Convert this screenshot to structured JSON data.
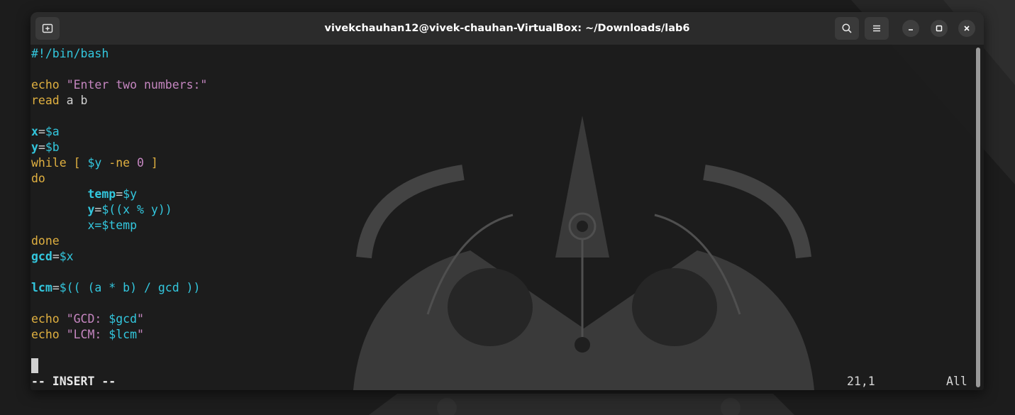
{
  "window": {
    "title": "vivekchauhan12@vivek-chauhan-VirtualBox: ~/Downloads/lab6"
  },
  "icons": {
    "new_tab": "new-tab-icon",
    "search": "search-icon",
    "menu": "hamburger-menu-icon",
    "minimize": "minimize-icon",
    "maximize": "maximize-icon",
    "close": "close-icon"
  },
  "editor": {
    "lines": [
      [
        {
          "t": "#!/bin/bash",
          "c": "shebang"
        }
      ],
      [],
      [
        {
          "t": "echo",
          "c": "kw"
        },
        {
          "t": " ",
          "c": "plain"
        },
        {
          "t": "\"Enter two numbers:\"",
          "c": "str"
        }
      ],
      [
        {
          "t": "read",
          "c": "kw"
        },
        {
          "t": " a b",
          "c": "plain"
        }
      ],
      [],
      [
        {
          "t": "x",
          "c": "var"
        },
        {
          "t": "=",
          "c": "plain"
        },
        {
          "t": "$a",
          "c": "exp"
        }
      ],
      [
        {
          "t": "y",
          "c": "var"
        },
        {
          "t": "=",
          "c": "plain"
        },
        {
          "t": "$b",
          "c": "exp"
        }
      ],
      [
        {
          "t": "while",
          "c": "kw"
        },
        {
          "t": " ",
          "c": "plain"
        },
        {
          "t": "[",
          "c": "kw"
        },
        {
          "t": " ",
          "c": "plain"
        },
        {
          "t": "$y",
          "c": "exp"
        },
        {
          "t": " ",
          "c": "plain"
        },
        {
          "t": "-ne",
          "c": "kw"
        },
        {
          "t": " ",
          "c": "plain"
        },
        {
          "t": "0",
          "c": "num"
        },
        {
          "t": " ",
          "c": "plain"
        },
        {
          "t": "]",
          "c": "kw"
        }
      ],
      [
        {
          "t": "do",
          "c": "kw"
        }
      ],
      [
        {
          "t": "        ",
          "c": "plain"
        },
        {
          "t": "temp",
          "c": "var"
        },
        {
          "t": "=",
          "c": "plain"
        },
        {
          "t": "$y",
          "c": "exp"
        }
      ],
      [
        {
          "t": "        ",
          "c": "plain"
        },
        {
          "t": "y",
          "c": "var"
        },
        {
          "t": "=",
          "c": "plain"
        },
        {
          "t": "$((x % y))",
          "c": "exp"
        }
      ],
      [
        {
          "t": "        ",
          "c": "plain"
        },
        {
          "t": "x=",
          "c": "exp"
        },
        {
          "t": "$temp",
          "c": "exp"
        }
      ],
      [
        {
          "t": "done",
          "c": "kw"
        }
      ],
      [
        {
          "t": "gcd",
          "c": "var"
        },
        {
          "t": "=",
          "c": "plain"
        },
        {
          "t": "$x",
          "c": "exp"
        }
      ],
      [],
      [
        {
          "t": "lcm",
          "c": "var"
        },
        {
          "t": "=",
          "c": "plain"
        },
        {
          "t": "$(( (a * b) / gcd ))",
          "c": "exp"
        }
      ],
      [],
      [
        {
          "t": "echo",
          "c": "kw"
        },
        {
          "t": " ",
          "c": "plain"
        },
        {
          "t": "\"GCD: ",
          "c": "str"
        },
        {
          "t": "$gcd",
          "c": "exp"
        },
        {
          "t": "\"",
          "c": "str"
        }
      ],
      [
        {
          "t": "echo",
          "c": "kw"
        },
        {
          "t": " ",
          "c": "plain"
        },
        {
          "t": "\"LCM: ",
          "c": "str"
        },
        {
          "t": "$lcm",
          "c": "exp"
        },
        {
          "t": "\"",
          "c": "str"
        }
      ],
      [],
      []
    ]
  },
  "statusline": {
    "mode": "-- INSERT --",
    "position": "21,1",
    "scroll": "All"
  }
}
